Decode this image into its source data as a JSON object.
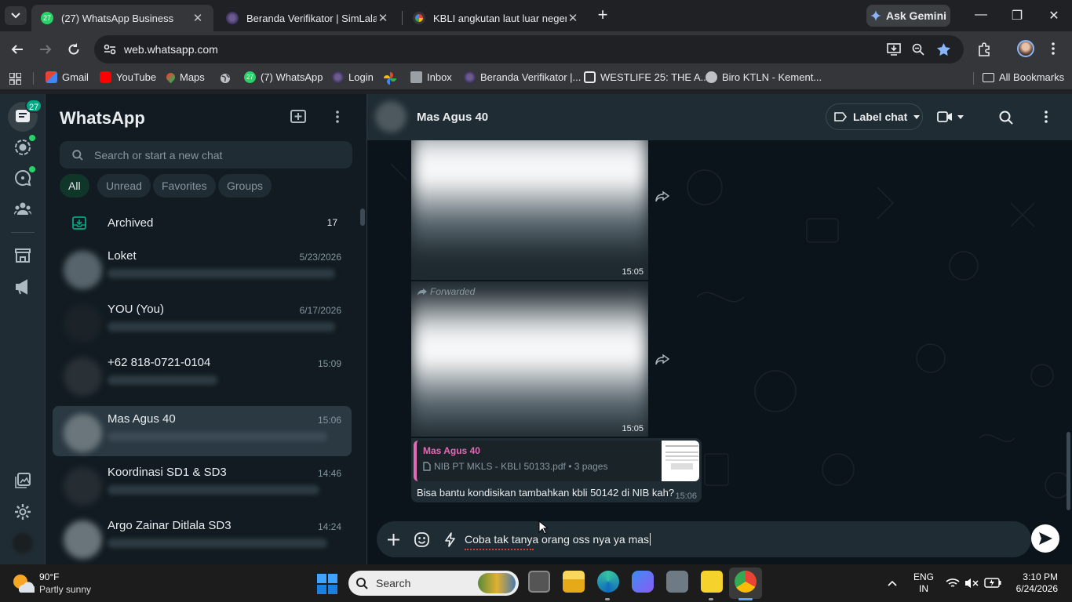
{
  "browser": {
    "tabs": [
      {
        "title": "(27) WhatsApp Business",
        "active": true
      },
      {
        "title": "Beranda Verifikator | SimLala",
        "active": false
      },
      {
        "title": "KBLI angkutan laut luar negeri u",
        "active": false
      }
    ],
    "ask_gemini": "Ask Gemini",
    "url": "web.whatsapp.com",
    "bookmarks": [
      "Gmail",
      "YouTube",
      "Maps",
      "(7) WhatsApp",
      "Login",
      "Inbox",
      "Beranda Verifikator |...",
      "WESTLIFE 25: THE A...",
      "Biro KTLN - Kement..."
    ],
    "all_bookmarks": "All Bookmarks"
  },
  "whatsapp": {
    "rail_badge": "27",
    "title": "WhatsApp",
    "search_placeholder": "Search or start a new chat",
    "filters": [
      "All",
      "Unread",
      "Favorites",
      "Groups"
    ],
    "archived": {
      "label": "Archived",
      "count": "17"
    },
    "chats": [
      {
        "name": "Loket",
        "time": "5/23/2026"
      },
      {
        "name": "YOU (You)",
        "time": "6/17/2026"
      },
      {
        "name": "+62 818-0721-0104",
        "time": "15:09"
      },
      {
        "name": "Mas Agus 40",
        "time": "15:06",
        "selected": true
      },
      {
        "name": "Koordinasi SD1 & SD3",
        "time": "14:46"
      },
      {
        "name": "Argo Zainar Ditlala SD3",
        "time": "14:24"
      }
    ],
    "conversation": {
      "contact_name": "Mas Agus 40",
      "label_chat": "Label chat",
      "messages": [
        {
          "type": "media",
          "time": "15:05"
        },
        {
          "type": "media",
          "forwarded_label": "Forwarded",
          "time": "15:05"
        },
        {
          "type": "reply",
          "quoted_sender": "Mas Agus 40",
          "quoted_file": "NIB PT MKLS - KBLI 50133.pdf • 3 pages",
          "text": "Bisa bantu kondisikan tambahkan kbli 50142 di NIB kah?",
          "time": "15:06"
        }
      ],
      "draft": "Coba tak tanya orang oss nya ya mas"
    }
  },
  "taskbar": {
    "weather_temp": "90°F",
    "weather_desc": "Partly sunny",
    "search": "Search",
    "lang_line1": "ENG",
    "lang_line2": "IN",
    "time": "3:10 PM",
    "date": "6/24/2026"
  },
  "colors": {
    "wa_green": "#00a884",
    "chip_active": "#103529",
    "quoted_accent": "#e26ab6"
  }
}
